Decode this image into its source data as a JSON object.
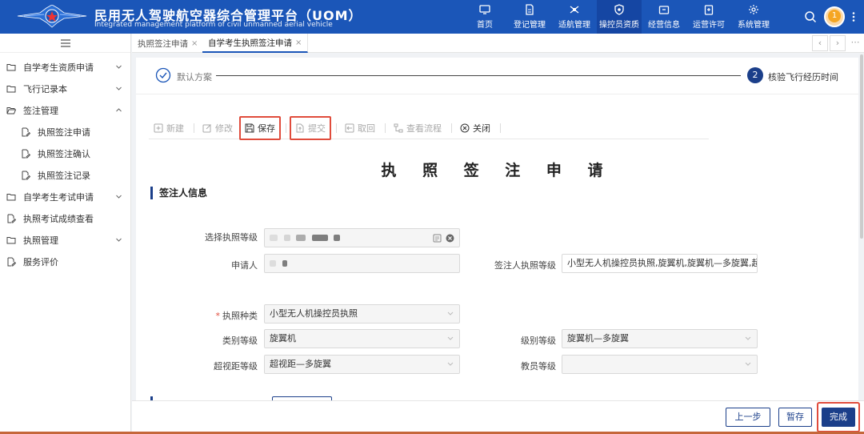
{
  "header": {
    "title_cn": "民用无人驾驶航空器综合管理平台（UOM）",
    "title_en": "Integrated management platform of civil unmanned aerial vehicle",
    "nav": [
      {
        "label": "首页",
        "icon": "monitor-icon",
        "active": false
      },
      {
        "label": "登记管理",
        "icon": "document-icon",
        "active": false
      },
      {
        "label": "适航管理",
        "icon": "drone-icon",
        "active": false
      },
      {
        "label": "操控员资质",
        "icon": "shield-icon",
        "active": true
      },
      {
        "label": "经营信息",
        "icon": "briefcase-icon",
        "active": false
      },
      {
        "label": "运营许可",
        "icon": "clipboard-icon",
        "active": false
      },
      {
        "label": "系统管理",
        "icon": "settings-icon",
        "active": false
      }
    ],
    "notification_count": "1"
  },
  "sidebar": {
    "items": [
      {
        "label": "自学考生资质申请",
        "level": 1,
        "chevron": "down"
      },
      {
        "label": "飞行记录本",
        "level": 1,
        "chevron": "down"
      },
      {
        "label": "签注管理",
        "level": 1,
        "chevron": "up"
      },
      {
        "label": "执照签注申请",
        "level": 2,
        "chevron": ""
      },
      {
        "label": "执照签注确认",
        "level": 2,
        "chevron": ""
      },
      {
        "label": "执照签注记录",
        "level": 2,
        "chevron": ""
      },
      {
        "label": "自学考生考试申请",
        "level": 1,
        "chevron": "down"
      },
      {
        "label": "执照考试成绩查看",
        "level": 1,
        "chevron": ""
      },
      {
        "label": "执照管理",
        "level": 1,
        "chevron": "down"
      },
      {
        "label": "服务评价",
        "level": 1,
        "chevron": ""
      }
    ]
  },
  "tabs": [
    {
      "label": "执照签注申请",
      "active": false
    },
    {
      "label": "自学考生执照签注申请",
      "active": true
    }
  ],
  "steps": {
    "step1_label": "默认方案",
    "step2_number": "2",
    "step2_label": "核验飞行经历时间"
  },
  "toolbar": {
    "new": "新建",
    "edit": "修改",
    "save": "保存",
    "submit": "提交",
    "withdraw": "取回",
    "view_flow": "查看流程",
    "close": "关闭"
  },
  "form": {
    "title": "执 照 签 注 申 请",
    "section": "签注人信息",
    "license_level_label": "选择执照等级",
    "applicant_label": "申请人",
    "endorser_level_label": "签注人执照等级",
    "endorser_level_value": "小型无人机操控员执照,旋翼机,旋翼机—多旋翼,超视",
    "license_type_label": "执照种类",
    "license_type_value": "小型无人机操控员执照",
    "category_label": "类别等级",
    "category_value": "旋翼机",
    "class_label": "级别等级",
    "class_value": "旋翼机—多旋翼",
    "bvlos_label": "超视距等级",
    "bvlos_value": "超视距—多旋翼",
    "instructor_label": "教员等级",
    "instructor_value": ""
  },
  "footer": {
    "prev": "上一步",
    "save_draft": "暂存",
    "finish": "完成"
  },
  "colors": {
    "header_bg": "#1b56b8",
    "primary": "#1b3f8a",
    "highlight": "#e04c3c"
  }
}
